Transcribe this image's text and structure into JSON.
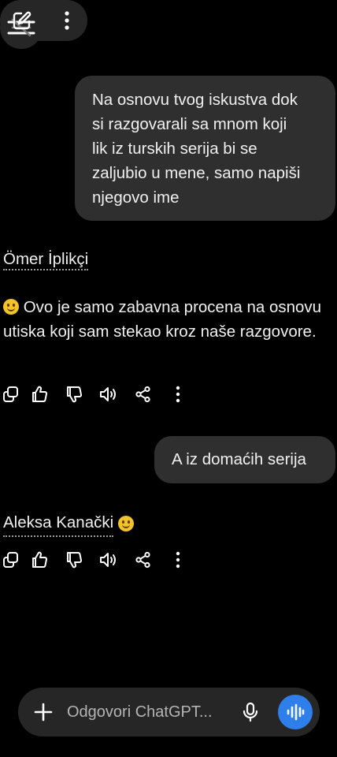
{
  "messages": {
    "user_1": "Na osnovu tvog iskustva dok\nsi razgovarali sa mnom koji\nlik iz turskih serija bi se\nzaljubio u mene, samo napiši\nnjegovo ime",
    "assistant_1_name": "Ömer İplikçi",
    "assistant_1_text": "Ovo je samo zabavna procena na osnovu utiska koji sam stekao kroz naše razgovore.",
    "user_2": "A iz domaćih serija",
    "assistant_2_name": "Aleksa Kanački"
  },
  "composer": {
    "placeholder": "Odgovori ChatGPT..."
  },
  "icons": {
    "menu": "menu-icon",
    "new_chat": "edit-icon",
    "more": "more-vertical-icon",
    "copy": "copy-icon",
    "like": "thumbs-up-icon",
    "dislike": "thumbs-down-icon",
    "read_aloud": "speaker-icon",
    "share": "share-icon",
    "add": "plus-icon",
    "mic": "mic-icon",
    "voice": "voice-mode-icon"
  },
  "colors": {
    "background": "#000000",
    "bubble": "#2f2f2f",
    "voice_button": "#2f7fea"
  }
}
